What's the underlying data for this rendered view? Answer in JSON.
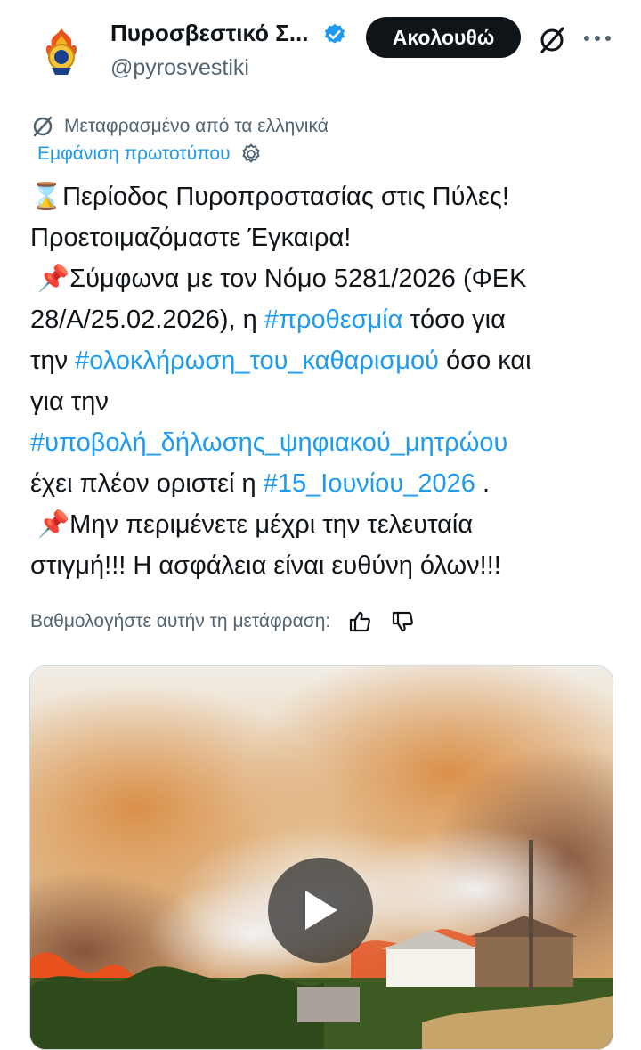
{
  "account": {
    "display_name": "Πυροσβεστικό Σ...",
    "handle": "@pyrosvestiki",
    "follow_label": "Ακολουθώ",
    "verified_color": "#1d9bf0"
  },
  "translation": {
    "notice": "Μεταφρασμένο από τα ελληνικά",
    "show_original": "Εμφάνιση πρωτοτύπου"
  },
  "tweet": {
    "l1_icon": "⌛",
    "l1_text": "Περίοδος Πυροπροστασίας στις Πύλες!",
    "l2_text": "Προετοιμαζόμαστε Έγκαιρα!",
    "l3_icon": "📌",
    "l3_text": "Σύμφωνα με τον Νόμο 5281/2026 (ΦΕΚ",
    "l4_text": "28/Α/25.02.2026), η ",
    "l4_tag": "#προθεσμία",
    "l4_tail": " τόσο για",
    "l5_text": "την ",
    "l5_tag": "#ολοκλήρωση_του_καθαρισμού",
    "l5_tail": " όσο και",
    "l6_text": "για την",
    "l7_tag": "#υποβολή_δήλωσης_ψηφιακού_μητρώου",
    "l8_text": "έχει πλέον οριστεί η ",
    "l8_tag": "#15_Ιουνίου_2026",
    "l8_tail": " .",
    "l9_icon": "📌",
    "l9_text": "Μην περιμένετε μέχρι την τελευταία",
    "l10_text": "στιγμή!!! Η ασφάλεια είναι ευθύνη όλων!!!"
  },
  "rating": {
    "label": "Βαθμολογήστε αυτήν τη μετάφραση:"
  },
  "icons": {
    "verified": "verified-badge-icon",
    "grok": "grok-icon",
    "more": "more-icon",
    "translate": "translate-icon",
    "settings": "gear-icon",
    "thumb_up": "thumbs-up-icon",
    "thumb_down": "thumbs-down-icon",
    "play": "play-icon"
  },
  "colors": {
    "link": "#1d9bf0",
    "secondary_text": "#536471",
    "primary_text": "#0f1419"
  }
}
